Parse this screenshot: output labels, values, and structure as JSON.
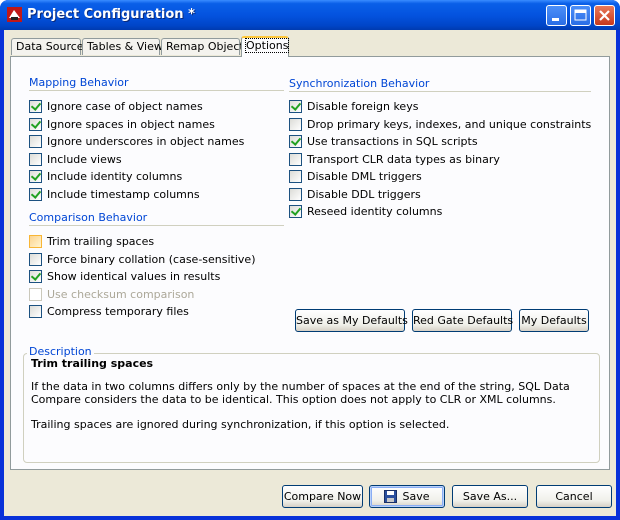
{
  "window": {
    "title": "Project Configuration *"
  },
  "tabs": [
    {
      "label": "Data Sources",
      "active": false
    },
    {
      "label": "Tables & Views",
      "active": false
    },
    {
      "label": "Remap Objects",
      "active": false
    },
    {
      "label": "Options",
      "active": true
    }
  ],
  "mapping": {
    "title": "Mapping Behavior",
    "items": [
      {
        "label": "Ignore case of object names",
        "checked": true
      },
      {
        "label": "Ignore spaces in object names",
        "checked": true
      },
      {
        "label": "Ignore underscores in object names",
        "checked": false
      },
      {
        "label": "Include views",
        "checked": false
      },
      {
        "label": "Include identity columns",
        "checked": true
      },
      {
        "label": "Include timestamp columns",
        "checked": true
      }
    ]
  },
  "comparison": {
    "title": "Comparison Behavior",
    "items": [
      {
        "label": "Trim trailing spaces",
        "checked": false
      },
      {
        "label": "Force binary collation (case-sensitive)",
        "checked": false
      },
      {
        "label": "Show identical values in results",
        "checked": true
      },
      {
        "label": "Use checksum comparison",
        "checked": false
      },
      {
        "label": "Compress temporary files",
        "checked": false
      }
    ]
  },
  "sync": {
    "title": "Synchronization Behavior",
    "items": [
      {
        "label": "Disable foreign keys",
        "checked": true
      },
      {
        "label": "Drop primary keys, indexes, and unique constraints",
        "checked": false
      },
      {
        "label": "Use transactions in SQL scripts",
        "checked": true
      },
      {
        "label": "Transport CLR data types as binary",
        "checked": false
      },
      {
        "label": "Disable DML triggers",
        "checked": false
      },
      {
        "label": "Disable DDL triggers",
        "checked": false
      },
      {
        "label": "Reseed identity columns",
        "checked": true
      }
    ]
  },
  "defaults": {
    "save_as_my": "Save as My Defaults",
    "red_gate": "Red Gate Defaults",
    "my": "My Defaults"
  },
  "description": {
    "title": "Description",
    "heading": "Trim trailing spaces",
    "paragraph1": "If the data in two columns differs only by the number of spaces at the end of the string, SQL Data Compare considers the data to be identical. This option does not apply to CLR or XML columns.",
    "paragraph2": "Trailing spaces are ignored during synchronization, if this option is selected."
  },
  "footer": {
    "compare_now": "Compare Now",
    "save": "Save",
    "save_as": "Save As...",
    "cancel": "Cancel"
  },
  "colors": {
    "title_bar": "#0453df",
    "accent": "#0046d5",
    "check": "#21a121"
  }
}
